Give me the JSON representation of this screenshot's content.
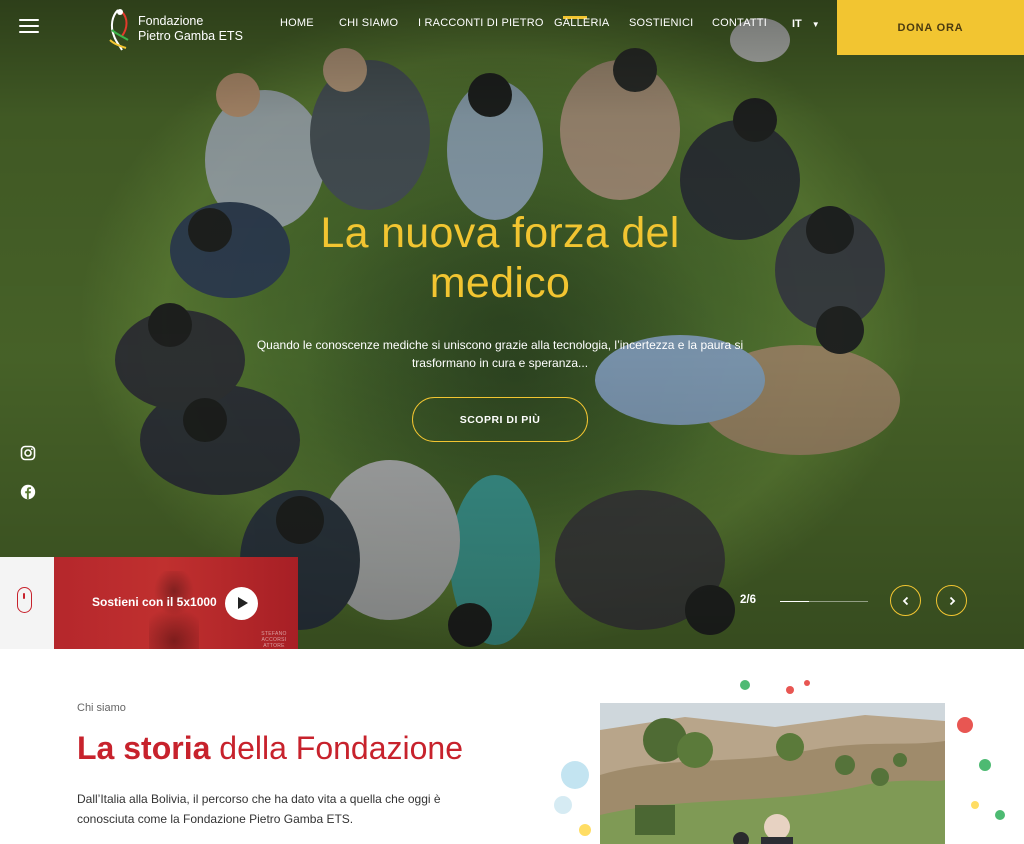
{
  "header": {
    "logo_text_line1": "Fondazione",
    "logo_text_line2": "Pietro Gamba ETS",
    "nav": [
      "HOME",
      "CHI SIAMO",
      "I RACCONTI DI PIETRO",
      "GALLERIA",
      "SOSTIENICI",
      "CONTATTI"
    ],
    "language": "IT",
    "donate_label": "DONA ORA"
  },
  "hero": {
    "title": "La nuova forza del medico",
    "subtitle": "Quando le conoscenze mediche si uniscono grazie alla tecnologia, l’incertezza e la paura si trasformano in cura e speranza...",
    "cta_label": "SCOPRI DI PIÙ",
    "video_label": "Sostieni con il 5x1000",
    "video_credit_line1": "STEFANO ACCORSI",
    "video_credit_line2": "ATTORE",
    "counter": "2/6",
    "slide_current": 2,
    "slide_total": 6,
    "progress_fraction": 0.33
  },
  "about": {
    "eyebrow": "Chi siamo",
    "title_bold": "La storia",
    "title_rest": " della Fondazione",
    "text": "Dall’Italia alla Bolivia, il percorso che ha dato vita a quella che oggi è conosciuta come la Fondazione Pietro Gamba ETS."
  },
  "icons": {
    "menu": "hamburger-icon",
    "social": [
      "instagram-icon",
      "facebook-icon"
    ],
    "scroll": "mouse-scroll-icon",
    "play": "play-icon",
    "prev": "chevron-left-icon",
    "next": "chevron-right-icon"
  },
  "colors": {
    "accent_yellow": "#f2c531",
    "brand_red": "#c7222c",
    "grass_green": "#4f7230"
  }
}
